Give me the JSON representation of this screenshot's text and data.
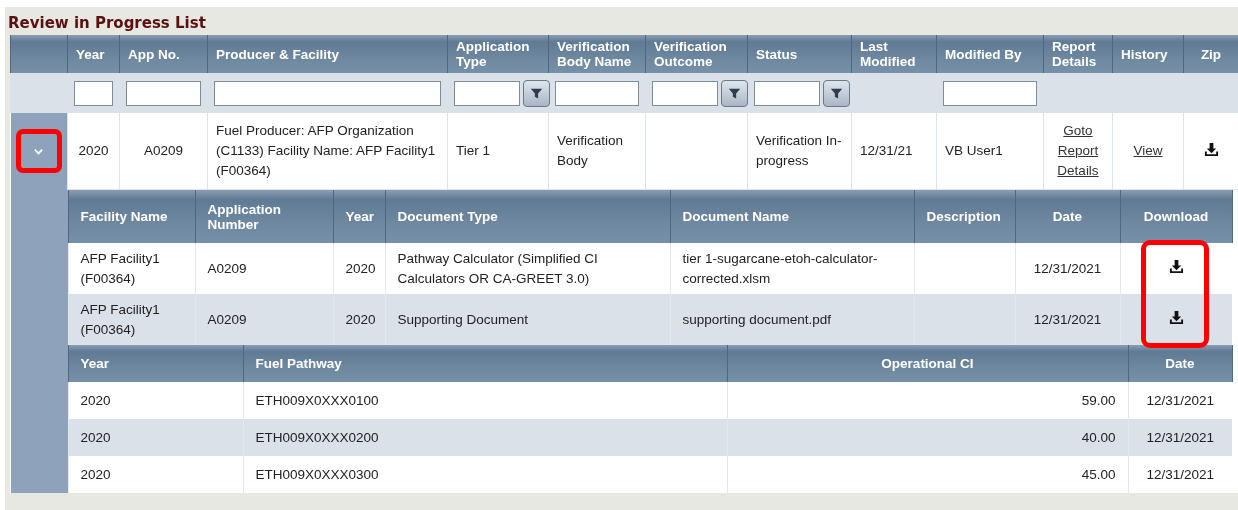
{
  "title": "Review in Progress List",
  "table": {
    "columns": [
      "Year",
      "App No.",
      "Producer & Facility",
      "Application Type",
      "Verification Body Name",
      "Verification Outcome",
      "Status",
      "Last Modified",
      "Modified By",
      "Report Details",
      "History",
      "Zip"
    ],
    "filters": [
      {
        "kind": "text"
      },
      {
        "kind": "text"
      },
      {
        "kind": "text"
      },
      {
        "kind": "dropdown"
      },
      {
        "kind": "text"
      },
      {
        "kind": "dropdown"
      },
      {
        "kind": "dropdown"
      },
      {
        "kind": "none"
      },
      {
        "kind": "text"
      },
      {
        "kind": "none"
      },
      {
        "kind": "none"
      },
      {
        "kind": "none"
      }
    ],
    "rows": [
      {
        "expanded": true,
        "highlighted": true,
        "year": "2020",
        "app_no": "A0209",
        "producer_facility": "Fuel Producer: AFP Organization (C1133) Facility Name: AFP Facility1 (F00364)",
        "application_type": "Tier 1",
        "verification_body_name": "Verification Body",
        "verification_outcome": "",
        "status": "Verification In-progress",
        "last_modified": "12/31/21",
        "modified_by": "VB User1",
        "report_details": "Goto Report Details",
        "history": "View",
        "documents": {
          "columns": [
            "Facility Name",
            "Application Number",
            "Year",
            "Document Type",
            "Document Name",
            "Description",
            "Date",
            "Download"
          ],
          "download_highlighted": true,
          "rows": [
            {
              "facility_name": "AFP Facility1 (F00364)",
              "application_number": "A0209",
              "year": "2020",
              "document_type": "Pathway Calculator (Simplified CI Calculators OR CA-GREET 3.0)",
              "document_name": "tier 1-sugarcane-etoh-calculator-corrected.xlsm",
              "date": "12/31/2021"
            },
            {
              "facility_name": "AFP Facility1 (F00364)",
              "application_number": "A0209",
              "year": "2020",
              "document_type": "Supporting Document",
              "document_name": "supporting document.pdf",
              "date": "12/31/2021"
            }
          ]
        },
        "pathways": {
          "columns": [
            "Year",
            "Fuel Pathway",
            "Operational CI",
            "Date"
          ],
          "rows": [
            {
              "year": "2020",
              "fuel_pathway": "ETH009X0XXX0100",
              "operational_ci": "59.00",
              "date": "12/31/2021"
            },
            {
              "year": "2020",
              "fuel_pathway": "ETH009X0XXX0200",
              "operational_ci": "40.00",
              "date": "12/31/2021"
            },
            {
              "year": "2020",
              "fuel_pathway": "ETH009X0XXX0300",
              "operational_ci": "45.00",
              "date": "12/31/2021"
            }
          ]
        }
      }
    ]
  }
}
